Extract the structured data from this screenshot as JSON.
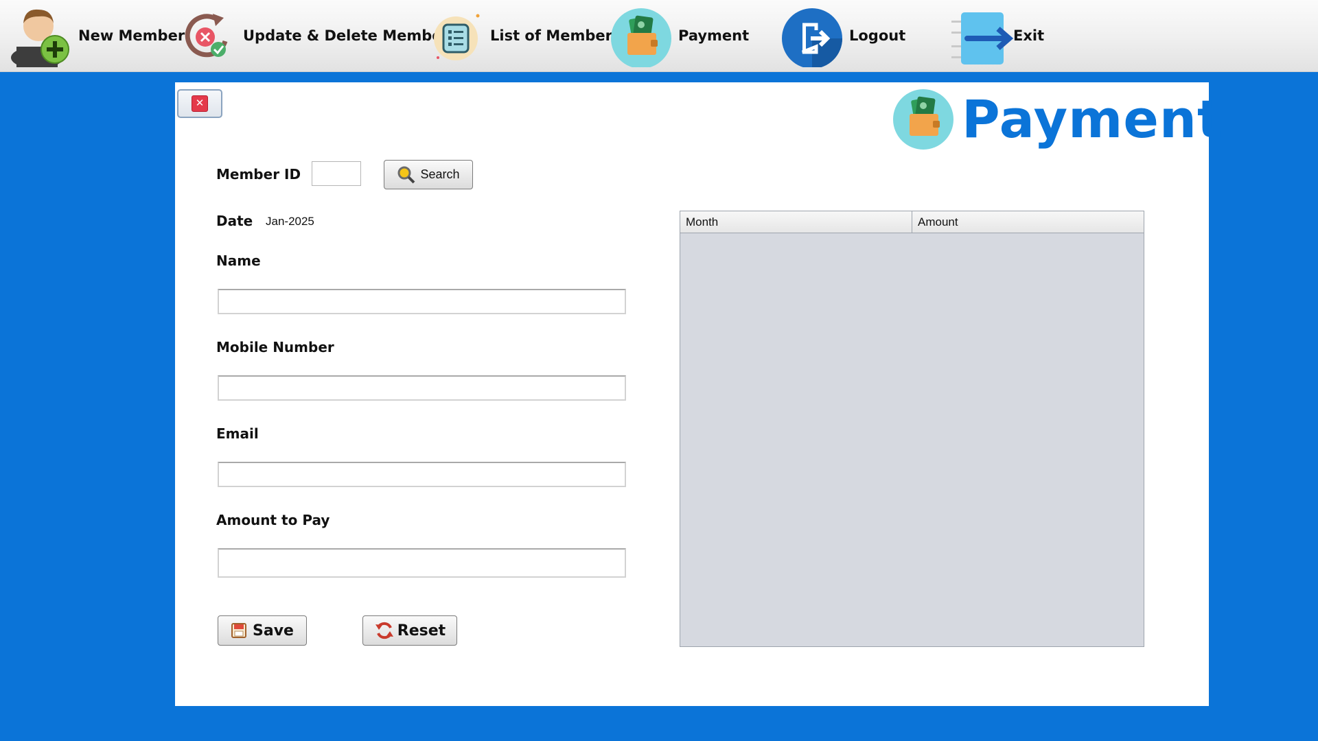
{
  "toolbar": {
    "items": [
      {
        "label": "New Member"
      },
      {
        "label": "Update & Delete Member"
      },
      {
        "label": "List of Members"
      },
      {
        "label": "Payment"
      },
      {
        "label": "Logout"
      },
      {
        "label": "Exit"
      }
    ]
  },
  "page": {
    "title": "Payment"
  },
  "form": {
    "member_id_label": "Member ID",
    "member_id_value": "",
    "search_label": "Search",
    "date_label": "Date",
    "date_value": "Jan-2025",
    "name_label": "Name",
    "name_value": "",
    "mobile_label": "Mobile Number",
    "mobile_value": "",
    "email_label": "Email",
    "email_value": "",
    "amount_label": "Amount to Pay",
    "amount_value": "",
    "save_label": "Save",
    "reset_label": "Reset"
  },
  "table": {
    "columns": [
      "Month",
      "Amount"
    ],
    "rows": []
  },
  "colors": {
    "background": "#0b74d8",
    "title": "#0b74d8",
    "panel": "#ffffff",
    "table_body": "#d6d9e0"
  },
  "icons": [
    "add-user-icon",
    "update-delete-icon",
    "list-icon",
    "wallet-icon",
    "logout-icon",
    "exit-icon",
    "close-icon",
    "search-icon",
    "save-icon",
    "reset-icon"
  ]
}
